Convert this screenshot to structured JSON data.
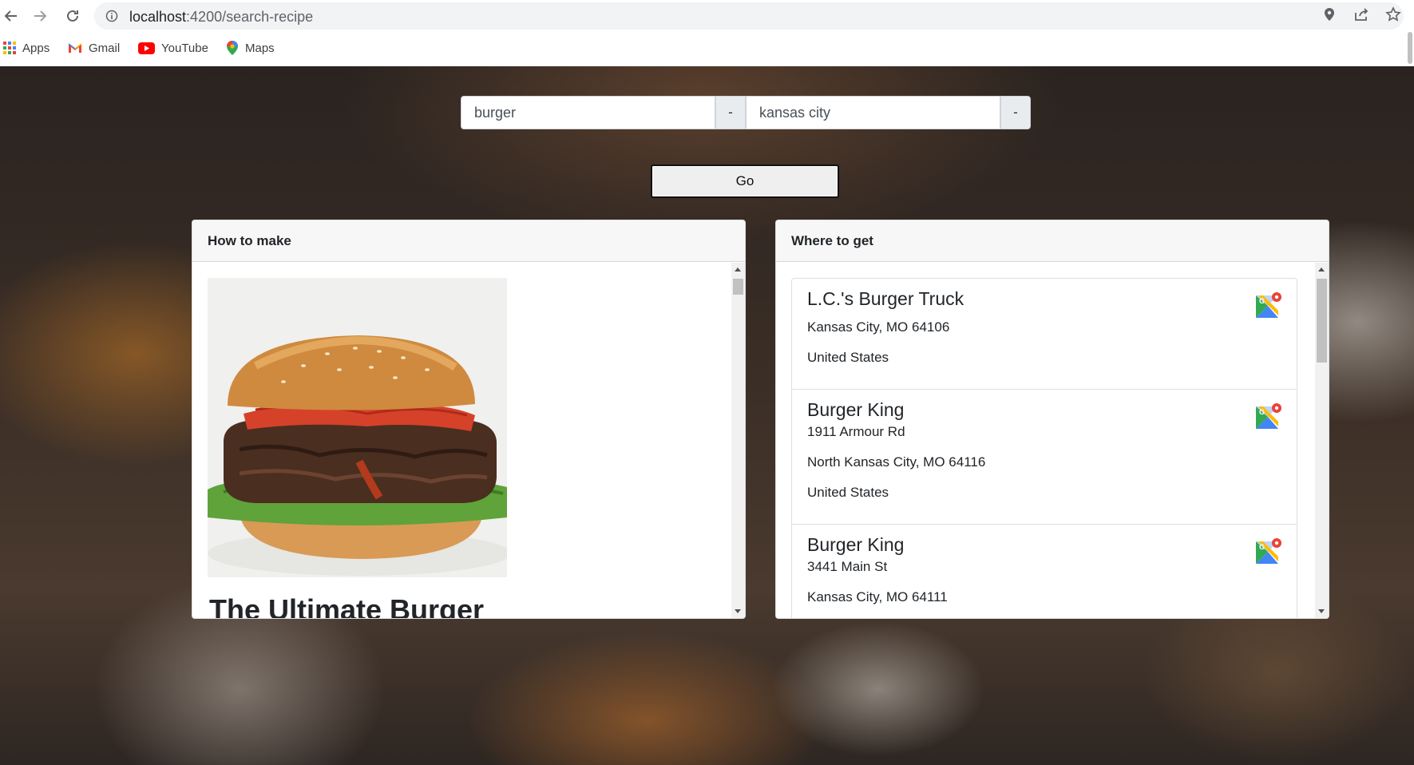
{
  "browser": {
    "url_host": "localhost",
    "url_path": ":4200/search-recipe",
    "bookmarks": [
      {
        "label": "Apps",
        "icon": "apps-grid-icon"
      },
      {
        "label": "Gmail",
        "icon": "gmail-icon"
      },
      {
        "label": "YouTube",
        "icon": "youtube-icon"
      },
      {
        "label": "Maps",
        "icon": "maps-icon"
      }
    ]
  },
  "search": {
    "food_value": "burger",
    "food_clear_label": "-",
    "location_value": "kansas city",
    "location_clear_label": "-",
    "go_label": "Go"
  },
  "recipe_card": {
    "header": "How to make",
    "title": "The Ultimate Burger"
  },
  "places_card": {
    "header": "Where to get",
    "places": [
      {
        "name": "L.C.'s Burger Truck",
        "lines": [
          "Kansas City, MO 64106",
          "United States"
        ]
      },
      {
        "name": "Burger King",
        "lines": [
          "1911 Armour Rd",
          "North Kansas City, MO 64116",
          "United States"
        ]
      },
      {
        "name": "Burger King",
        "lines": [
          "3441 Main St",
          "Kansas City, MO 64111"
        ]
      }
    ]
  }
}
